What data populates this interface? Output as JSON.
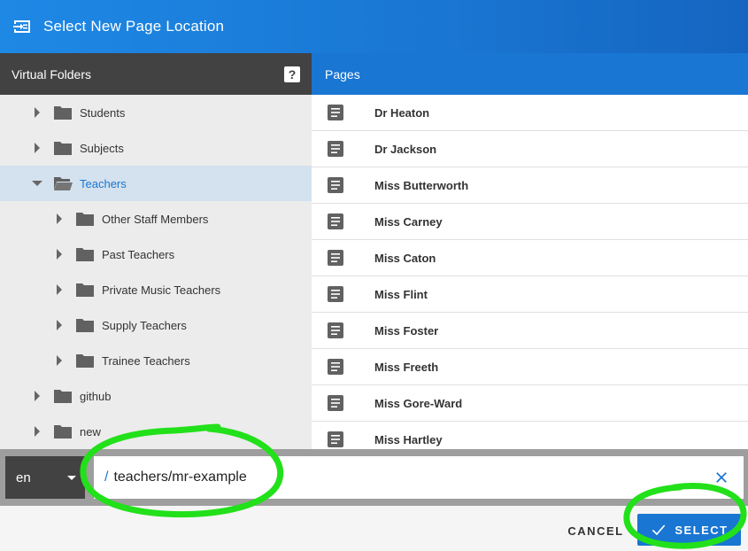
{
  "dialog": {
    "title": "Select New Page Location",
    "icon": "move-page-icon"
  },
  "folders": {
    "header": "Virtual Folders",
    "help_label": "?",
    "items": [
      {
        "label": "Students",
        "level": 0,
        "state": "collapsed"
      },
      {
        "label": "Subjects",
        "level": 0,
        "state": "collapsed"
      },
      {
        "label": "Teachers",
        "level": 0,
        "state": "expanded",
        "selected": true
      },
      {
        "label": "Other Staff Members",
        "level": 1,
        "state": "collapsed"
      },
      {
        "label": "Past Teachers",
        "level": 1,
        "state": "collapsed"
      },
      {
        "label": "Private Music Teachers",
        "level": 1,
        "state": "collapsed"
      },
      {
        "label": "Supply Teachers",
        "level": 1,
        "state": "collapsed"
      },
      {
        "label": "Trainee Teachers",
        "level": 1,
        "state": "collapsed"
      },
      {
        "label": "github",
        "level": 0,
        "state": "collapsed"
      },
      {
        "label": "new",
        "level": 0,
        "state": "collapsed"
      }
    ]
  },
  "pages": {
    "header": "Pages",
    "items": [
      "Dr Heaton",
      "Dr Jackson",
      "Miss Butterworth",
      "Miss Carney",
      "Miss Caton",
      "Miss Flint",
      "Miss Foster",
      "Miss Freeth",
      "Miss Gore-Ward",
      "Miss Hartley"
    ]
  },
  "locale": {
    "value": "en"
  },
  "path": {
    "prefix": "/",
    "value": "teachers/mr-example"
  },
  "actions": {
    "cancel_label": "CANCEL",
    "select_label": "SELECT"
  },
  "colors": {
    "accent": "#1976d2",
    "highlight": "#22e01a",
    "selected_row": "#d4e1ee"
  }
}
